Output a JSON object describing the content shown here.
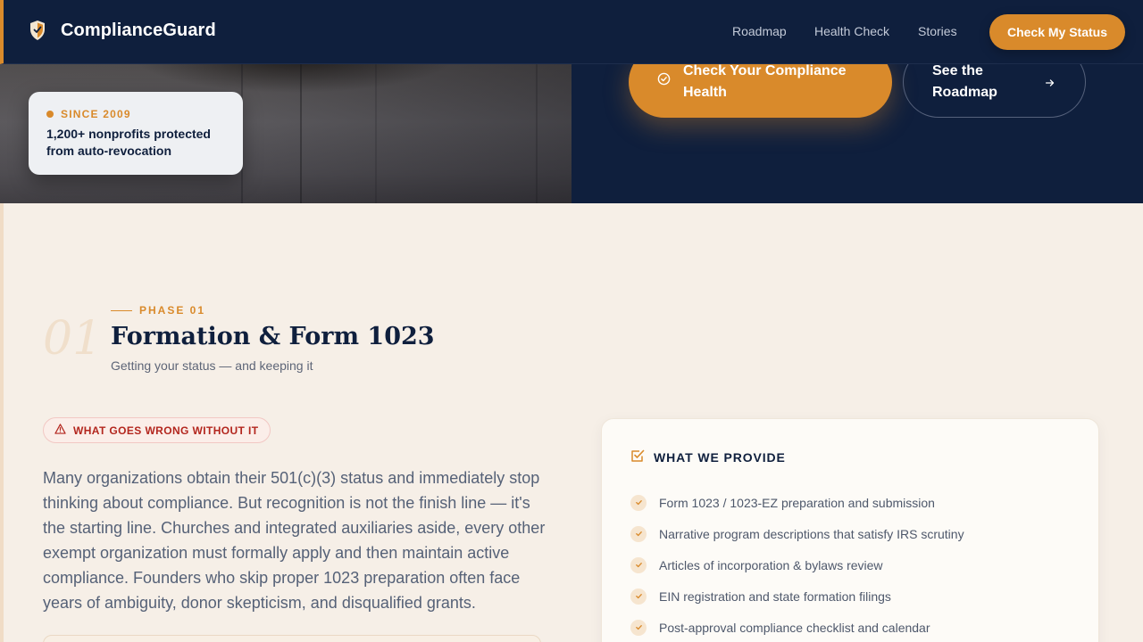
{
  "nav": {
    "brand": "ComplianceGuard",
    "links": [
      {
        "label": "Roadmap"
      },
      {
        "label": "Health Check"
      },
      {
        "label": "Stories"
      }
    ],
    "cta": "Check My Status"
  },
  "hero": {
    "since_label": "SINCE 2009",
    "since_text": "1,200+ nonprofits protected from auto-revocation",
    "primary_button": "Check Your Compliance Health",
    "secondary_button": "See the Roadmap"
  },
  "phase": {
    "number": "01",
    "label": "PHASE 01",
    "title": "Formation & Form 1023",
    "subtitle": "Getting your status — and keeping it",
    "warning": "WHAT GOES WRONG WITHOUT IT",
    "body": "Many organizations obtain their 501(c)(3) status and immediately stop thinking about compliance. But recognition is not the finish line — it's the starting line. Churches and integrated auxiliaries aside, every other exempt organization must formally apply and then maintain active compliance. Founders who skip proper 1023 preparation often face years of ambiguity, donor skepticism, and disqualified grants."
  },
  "provide": {
    "heading": "WHAT WE PROVIDE",
    "items": [
      "Form 1023 / 1023-EZ preparation and submission",
      "Narrative program descriptions that satisfy IRS scrutiny",
      "Articles of incorporation & bylaws review",
      "EIN registration and state formation filings",
      "Post-approval compliance checklist and calendar"
    ]
  },
  "colors": {
    "navy": "#0f1f3d",
    "accent": "#d98a2b",
    "cream": "#f6efe7",
    "warning": "#b3261e"
  },
  "icons": [
    "shield-logo-icon",
    "check-circle-icon",
    "arrow-right-icon",
    "warning-triangle-icon",
    "checklist-icon",
    "check-icon"
  ]
}
